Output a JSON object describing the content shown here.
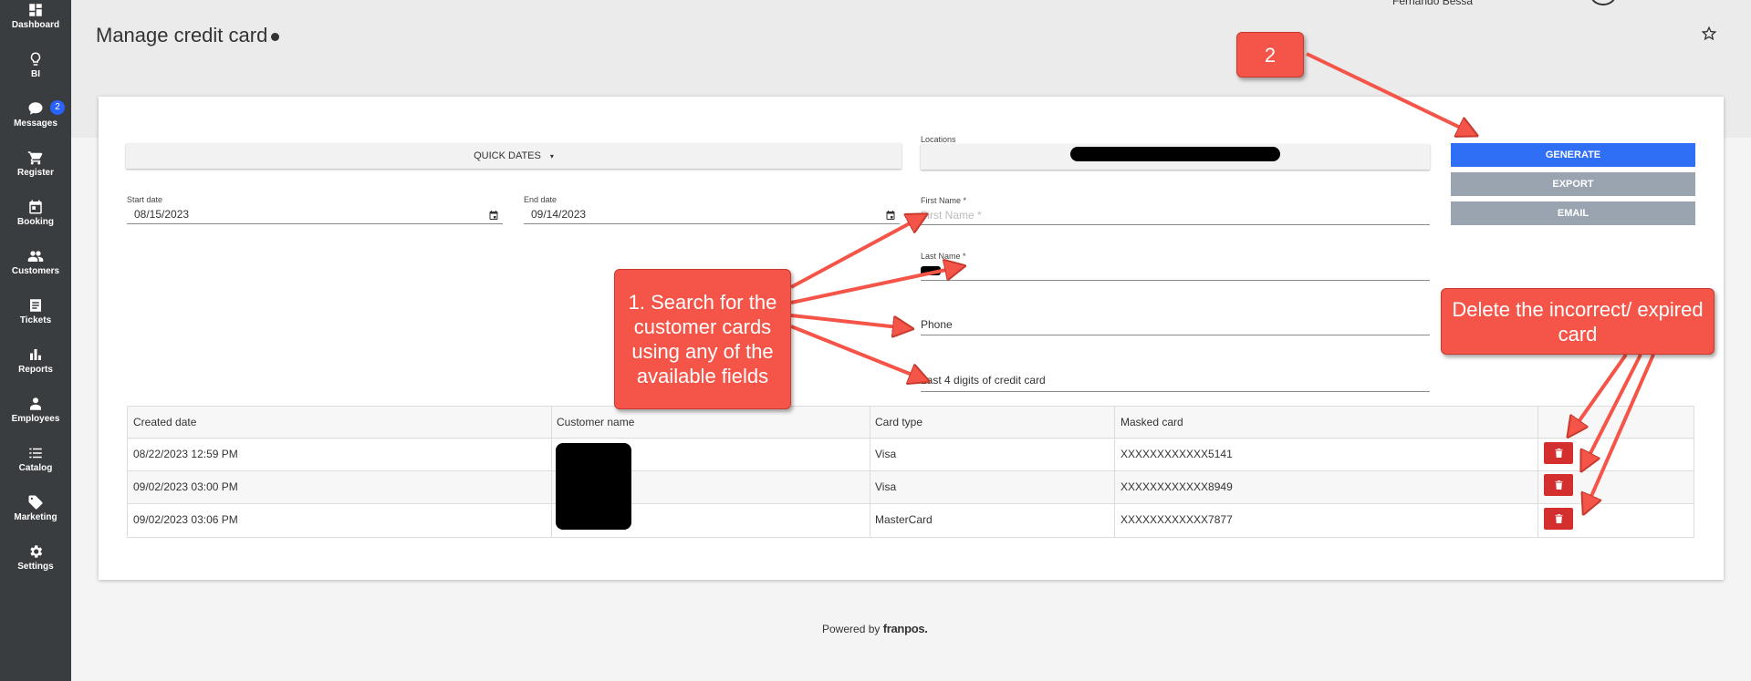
{
  "sidebar": {
    "items": [
      {
        "label": "Dashboard",
        "icon": "dashboard-icon"
      },
      {
        "label": "BI",
        "icon": "lightbulb-icon"
      },
      {
        "label": "Messages",
        "icon": "chat-icon",
        "badge": "2"
      },
      {
        "label": "Register",
        "icon": "cart-icon"
      },
      {
        "label": "Booking",
        "icon": "calendar-icon"
      },
      {
        "label": "Customers",
        "icon": "people-icon"
      },
      {
        "label": "Tickets",
        "icon": "ticket-icon"
      },
      {
        "label": "Reports",
        "icon": "bar-chart-icon"
      },
      {
        "label": "Employees",
        "icon": "person-icon"
      },
      {
        "label": "Catalog",
        "icon": "list-icon"
      },
      {
        "label": "Marketing",
        "icon": "tag-icon"
      },
      {
        "label": "Settings",
        "icon": "gear-icon"
      }
    ]
  },
  "header": {
    "title": "Manage credit card",
    "user_name": "Fernando Bessa"
  },
  "filters": {
    "quick_dates": "QUICK DATES",
    "locations_label": "Locations",
    "start_date_label": "Start date",
    "start_date": "08/15/2023",
    "end_date_label": "End date",
    "end_date": "09/14/2023",
    "first_name_label": "First Name *",
    "first_name_placeholder": "First Name *",
    "last_name_label": "Last Name *",
    "phone_placeholder": "Phone",
    "last4_placeholder": "Last 4 digits of credit card"
  },
  "actions": {
    "generate": "GENERATE",
    "export": "EXPORT",
    "email": "EMAIL"
  },
  "table": {
    "headers": [
      "Created date",
      "Customer name",
      "Card type",
      "Masked card"
    ],
    "rows": [
      {
        "created": "08/22/2023 12:59 PM",
        "type": "Visa",
        "masked": "XXXXXXXXXXXX5141"
      },
      {
        "created": "09/02/2023 03:00 PM",
        "type": "Visa",
        "masked": "XXXXXXXXXXXX8949"
      },
      {
        "created": "09/02/2023 03:06 PM",
        "type": "MasterCard",
        "masked": "XXXXXXXXXXXX7877"
      }
    ]
  },
  "footer": {
    "powered_by": "Powered by",
    "brand": "franpos."
  },
  "annotations": {
    "step1": "1. Search for the customer cards using any of the available fields",
    "step2": "2",
    "step3": "Delete the incorrect/ expired card"
  },
  "colors": {
    "sidebar": "#3a3d40",
    "primary": "#2f6ff5",
    "secondary": "#9aa3b0",
    "delete": "#d32f2f",
    "callout": "#f55548"
  }
}
